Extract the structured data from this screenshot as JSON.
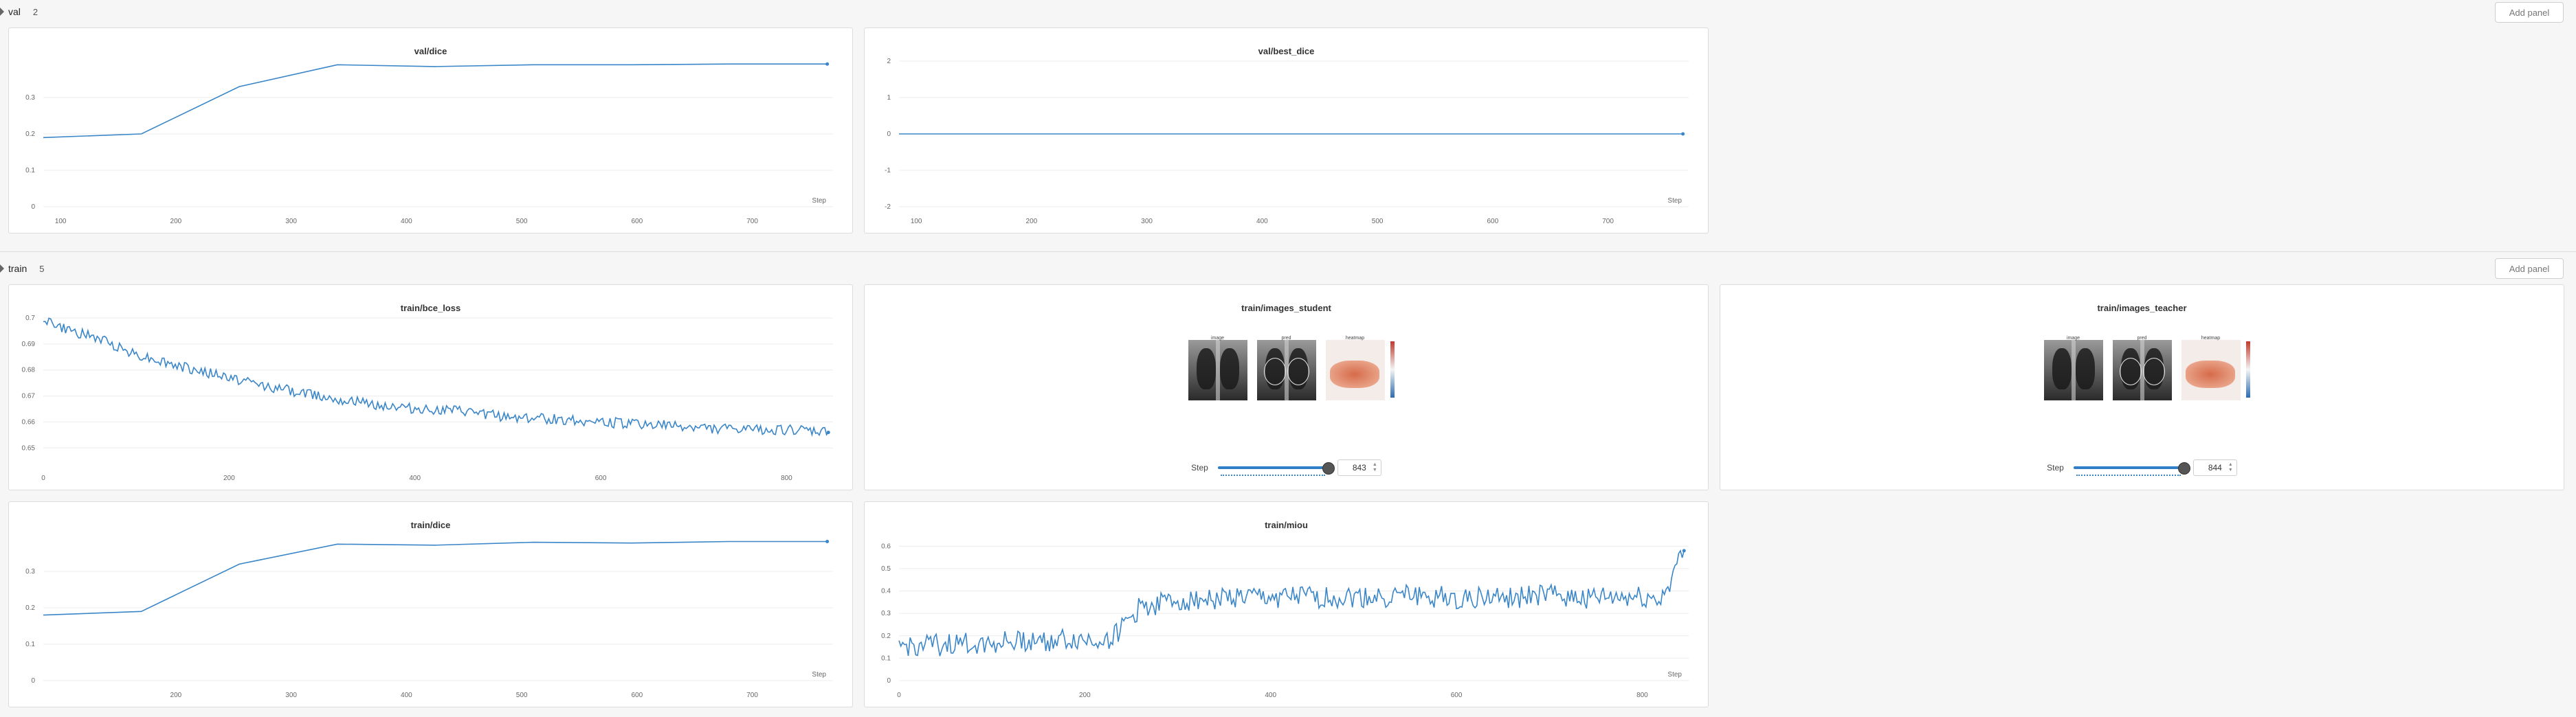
{
  "sections": [
    {
      "title": "val",
      "count": "2",
      "add_panel": "Add panel"
    },
    {
      "title": "train",
      "count": "5",
      "add_panel": "Add panel"
    }
  ],
  "colors": {
    "series": "#3a86c8",
    "background": "#f6f6f6",
    "panel": "#ffffff"
  },
  "media_panels": [
    {
      "title": "train/images_student",
      "step_label": "Step",
      "step_value": "843",
      "slider_fraction": 1.0,
      "image_captions": [
        "image",
        "pred",
        "heatmap"
      ]
    },
    {
      "title": "train/images_teacher",
      "step_label": "Step",
      "step_value": "844",
      "slider_fraction": 1.0,
      "image_captions": [
        "image",
        "pred",
        "heatmap"
      ]
    }
  ],
  "chart_data": [
    {
      "type": "line",
      "title": "val/dice",
      "xlabel": "Step",
      "xlim": [
        85,
        770
      ],
      "ylim": [
        0,
        0.4
      ],
      "xticks": [
        100,
        200,
        300,
        400,
        500,
        600,
        700
      ],
      "yticks": [
        0,
        0.1,
        0.2,
        0.3
      ],
      "x": [
        85,
        170,
        255,
        340,
        425,
        510,
        595,
        680,
        765
      ],
      "y": [
        0.19,
        0.2,
        0.33,
        0.39,
        0.385,
        0.39,
        0.39,
        0.392,
        0.392
      ],
      "grid": true
    },
    {
      "type": "line",
      "title": "val/best_dice",
      "xlabel": "Step",
      "xlim": [
        85,
        770
      ],
      "ylim": [
        -2,
        2
      ],
      "xticks": [
        100,
        200,
        300,
        400,
        500,
        600,
        700
      ],
      "yticks": [
        -2,
        -1,
        0,
        1,
        2
      ],
      "x": [
        85,
        765
      ],
      "y": [
        0,
        0
      ],
      "grid": true
    },
    {
      "type": "line",
      "title": "train/bce_loss",
      "xlabel": "",
      "xlim": [
        0,
        850
      ],
      "ylim": [
        0.644,
        0.7
      ],
      "xticks": [
        0,
        200,
        400,
        600,
        800
      ],
      "yticks": [
        0.65,
        0.66,
        0.67,
        0.68,
        0.69,
        0.7
      ],
      "x": [
        0,
        20,
        40,
        60,
        80,
        100,
        150,
        200,
        250,
        300,
        350,
        400,
        450,
        500,
        550,
        600,
        650,
        700,
        750,
        800,
        845
      ],
      "y": [
        0.7,
        0.696,
        0.694,
        0.692,
        0.689,
        0.686,
        0.681,
        0.677,
        0.673,
        0.67,
        0.667,
        0.665,
        0.664,
        0.662,
        0.661,
        0.66,
        0.659,
        0.658,
        0.657,
        0.657,
        0.656
      ],
      "noise": 0.002,
      "grid": true
    },
    {
      "type": "line",
      "title": "train/dice",
      "xlabel": "Step",
      "xlim": [
        85,
        770
      ],
      "ylim": [
        0,
        0.4
      ],
      "xticks": [
        200,
        300,
        400,
        500,
        600,
        700
      ],
      "yticks": [
        0,
        0.1,
        0.2,
        0.3
      ],
      "x": [
        85,
        170,
        255,
        340,
        425,
        510,
        595,
        680,
        765
      ],
      "y": [
        0.18,
        0.19,
        0.32,
        0.375,
        0.372,
        0.38,
        0.378,
        0.382,
        0.382
      ],
      "grid": true
    },
    {
      "type": "line",
      "title": "train/miou",
      "xlabel": "Step",
      "xlim": [
        0,
        850
      ],
      "ylim": [
        0,
        0.65
      ],
      "xticks": [
        0,
        200,
        400,
        600,
        800
      ],
      "yticks": [
        0,
        0.1,
        0.2,
        0.3,
        0.4,
        0.5,
        0.6
      ],
      "x": [
        0,
        50,
        100,
        150,
        200,
        230,
        260,
        300,
        350,
        400,
        450,
        500,
        550,
        600,
        650,
        700,
        750,
        800,
        820,
        845
      ],
      "y": [
        0.15,
        0.16,
        0.17,
        0.18,
        0.18,
        0.19,
        0.33,
        0.36,
        0.37,
        0.37,
        0.37,
        0.37,
        0.38,
        0.37,
        0.37,
        0.38,
        0.37,
        0.37,
        0.36,
        0.58
      ],
      "noise": 0.05,
      "grid": true
    }
  ]
}
